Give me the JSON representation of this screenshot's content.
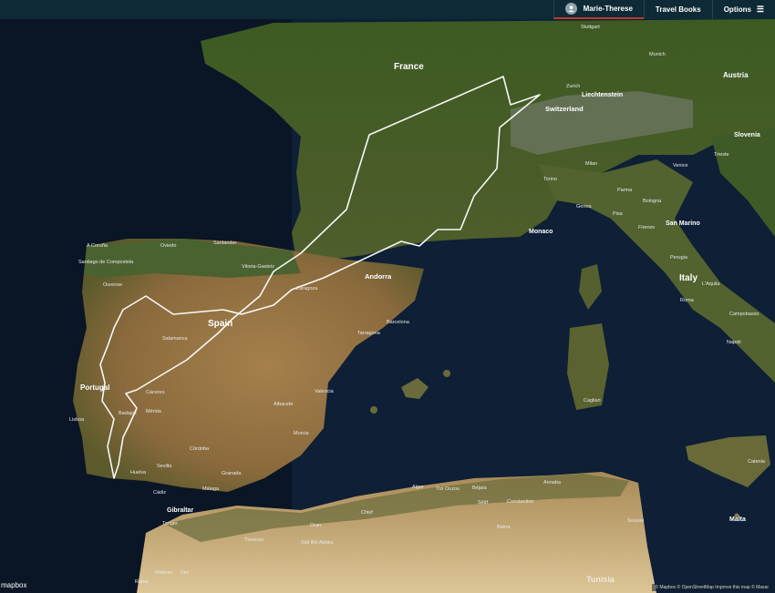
{
  "header": {
    "user_name": "Marie-Therese",
    "travel_books": "Travel Books",
    "options": "Options"
  },
  "map": {
    "logo": "mapbox",
    "attribution": "© Mapbox © OpenStreetMap Improve this map © Maxar",
    "countries": {
      "france": "France",
      "spain": "Spain",
      "portugal": "Portugal",
      "italy": "Italy",
      "andorra": "Andorra",
      "monaco": "Monaco",
      "switzerland": "Switzerland",
      "liechtenstein": "Liechtenstein",
      "austria": "Austria",
      "slovenia": "Slovenia",
      "san_marino": "San Marino",
      "gibraltar": "Gibraltar",
      "malta": "Malta",
      "tunisia": "Tunisia"
    },
    "cities": {
      "stuttgart": "Stuttgart",
      "munich": "Munich",
      "zurich": "Zurich",
      "a_coruna": "A Coruña",
      "oviedo": "Oviedo",
      "santander": "Santander",
      "santiago": "Santiago de Compostela",
      "ourense": "Ourense",
      "salamanca": "Salamanca",
      "valencia": "Valencia",
      "murcia": "Murcia",
      "cordoba": "Córdoba",
      "tarragona": "Tarragona",
      "barcelona": "Barcelona",
      "genoa": "Genoa",
      "milan": "Milan",
      "torino": "Torino",
      "bologna": "Bologna",
      "venice": "Venice",
      "trieste": "Trieste",
      "parma": "Parma",
      "pisa": "Pisa",
      "firenze": "Firenze",
      "perugia": "Perugia",
      "roma": "Roma",
      "laquila": "L'Aquila",
      "campobasso": "Campobasso",
      "napoli": "Napoli",
      "cagliari": "Cagliari",
      "catania": "Catania",
      "tanger": "Tanger",
      "tlemcen": "Tlemcen",
      "oran": "Oran",
      "alger": "Alger",
      "bejaia": "Béjaïa",
      "annaba": "Annaba",
      "constantine": "Constantine",
      "setif": "Sétif",
      "batna": "Batna",
      "rabat": "Rabat",
      "fes": "Fès",
      "meknes": "Meknès",
      "sidi_bel_abbes": "Sidi Bel Abbès",
      "chlef": "Chlef",
      "tizi_ouzou": "Tizi Ouzou",
      "sousse": "Sousse",
      "huelva": "Huelva",
      "badajoz": "Badajoz",
      "lisboa": "Lisboa",
      "merida": "Mérida",
      "caceres": "Cáceres",
      "cadiz": "Cádiz",
      "sevilla": "Sevilla",
      "granada": "Granada",
      "malaga": "Málaga",
      "albacete": "Albacete",
      "vitoria": "Vitoria-Gasteiz",
      "zaragoza": "Zaragoza"
    }
  }
}
